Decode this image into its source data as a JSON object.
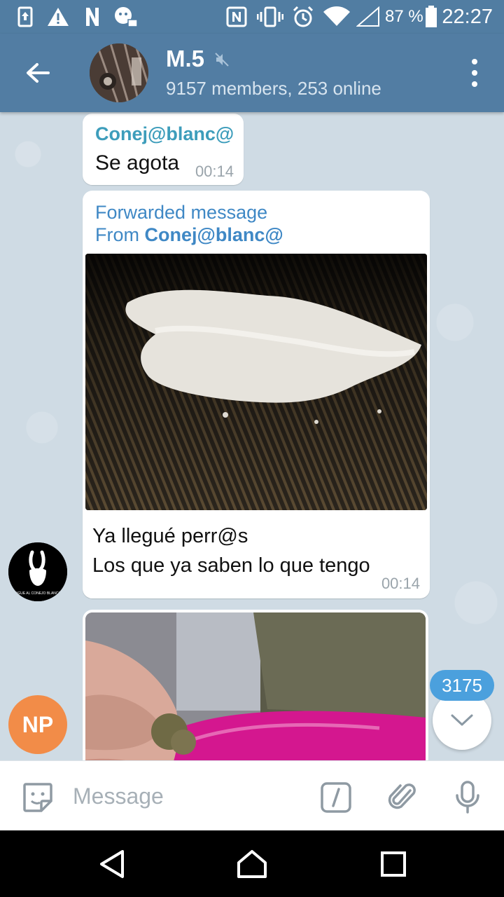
{
  "status_bar": {
    "battery": "87 %",
    "time": "22:27",
    "icons": [
      "upload-icon",
      "warning-icon",
      "n-app-icon",
      "notification-app-icon",
      "nfc-icon",
      "vibrate-icon",
      "alarm-icon",
      "wifi-icon",
      "signal-icon",
      "battery-icon"
    ]
  },
  "header": {
    "title": "M.5",
    "subtitle": "9157 members, 253 online",
    "muted": true
  },
  "messages": [
    {
      "sender": "Conej@blanc@",
      "text": "Se agota",
      "time": "00:14"
    },
    {
      "forwarded_label": "Forwarded message",
      "forwarded_prefix": "From ",
      "forwarded_from": "Conej@blanc@",
      "caption_line1": "Ya llegué perr@s",
      "caption_line2": "Los que ya saben lo que tengo",
      "time": "00:14"
    }
  ],
  "sender_avatar_text": "SIGUE AL CONEJO BLANCO",
  "np_avatar": "NP",
  "unread_count": "3175",
  "input": {
    "placeholder": "Message"
  },
  "colors": {
    "header": "#527da3",
    "sender_name": "#3d9dbb",
    "forward": "#3f88c5",
    "badge": "#4ba0dd",
    "np_avatar": "#f28c48"
  }
}
